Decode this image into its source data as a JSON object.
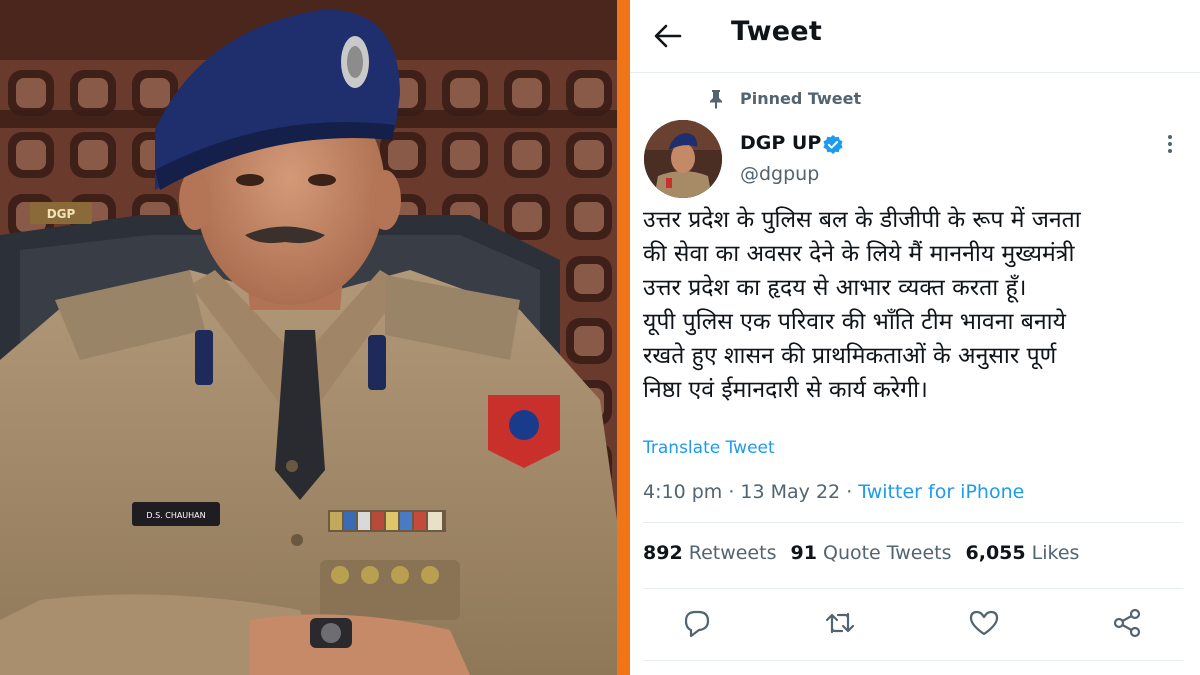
{
  "colors": {
    "accent_orange": "#f07418",
    "link_blue": "#1d9bf0",
    "text_primary": "#0f1419",
    "text_secondary": "#536471",
    "verified_blue": "#1d9bf0"
  },
  "header": {
    "back_icon": "arrow-left-icon",
    "title": "Tweet"
  },
  "pinned": {
    "icon": "pin-icon",
    "label": "Pinned Tweet"
  },
  "user": {
    "name": "DGP UP",
    "handle": "@dgpup",
    "verified_icon": "verified-badge-icon",
    "more_icon": "more-vertical-icon"
  },
  "tweet": {
    "lines": [
      "उत्तर प्रदेश के पुलिस बल के डीजीपी के रूप में जनता",
      "की सेवा का अवसर देने के लिये मैं माननीय मुख्यमंत्री",
      "उत्तर प्रदेश का हृदय से आभार व्यक्त करता हूँ।",
      "यूपी पुलिस एक परिवार की भाँति टीम भावना बनाये",
      "रखते हुए शासन की प्राथमिकताओं के अनुसार पूर्ण",
      "निष्ठा एवं ईमानदारी से कार्य करेगी।"
    ],
    "translate": "Translate Tweet",
    "time": "4:10 pm",
    "dot1": "·",
    "date": "13 May 22",
    "dot2": "·",
    "source": "Twitter for iPhone"
  },
  "stats": {
    "retweets_count": "892",
    "retweets_label": "Retweets",
    "quotes_count": "91",
    "quotes_label": "Quote Tweets",
    "likes_count": "6,055",
    "likes_label": "Likes"
  },
  "actions": {
    "reply_icon": "reply-icon",
    "retweet_icon": "retweet-icon",
    "like_icon": "heart-icon",
    "share_icon": "share-icon"
  },
  "photo": {
    "name_tag": "D.S. CHAUHAN",
    "desk_sign": "DGP"
  }
}
